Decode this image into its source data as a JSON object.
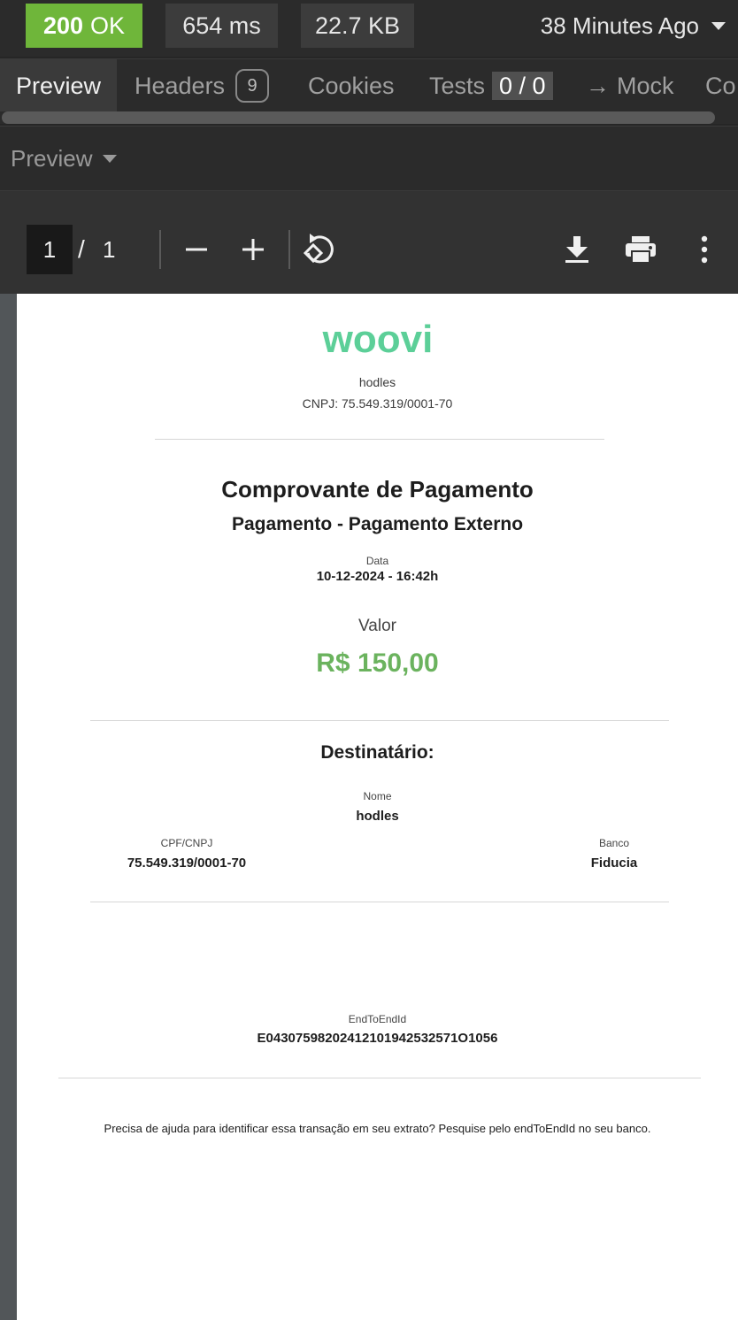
{
  "response": {
    "status_code": "200",
    "status_text": "OK",
    "time": "654 ms",
    "size": "22.7 KB",
    "history": "38 Minutes Ago"
  },
  "tabs": {
    "preview": "Preview",
    "headers": "Headers",
    "headers_count": "9",
    "cookies": "Cookies",
    "tests": "Tests",
    "tests_count": "0 / 0",
    "mock": "Mock",
    "console": "Co"
  },
  "preview_mode": "Preview",
  "pdf_toolbar": {
    "current_page": "1",
    "separator": "/",
    "total_pages": "1"
  },
  "document": {
    "brand": "woovi",
    "merchant_name": "hodles",
    "merchant_cnpj": "CNPJ: 75.549.319/0001-70",
    "title": "Comprovante de Pagamento",
    "subtitle": "Pagamento - Pagamento Externo",
    "date_label": "Data",
    "date_value": "10-12-2024 - 16:42h",
    "amount_label": "Valor",
    "amount_value": "R$ 150,00",
    "recipient_heading": "Destinatário:",
    "name_label": "Nome",
    "name_value": "hodles",
    "doc_label": "CPF/CNPJ",
    "doc_value": "75.549.319/0001-70",
    "bank_label": "Banco",
    "bank_value": "Fiducia",
    "e2e_label": "EndToEndId",
    "e2e_value": "E04307598202412101942532571O1056",
    "help_text": "Precisa de ajuda para identificar essa transação em seu extrato? Pesquise pelo endToEndId no seu banco."
  },
  "colors": {
    "status_ok": "#6fb63a",
    "brand_green": "#5ccf98",
    "amount_green": "#6bb35e"
  },
  "icons": [
    "zoom-out-icon",
    "zoom-in-icon",
    "rotate-icon",
    "download-icon",
    "print-icon",
    "more-vertical-icon"
  ]
}
